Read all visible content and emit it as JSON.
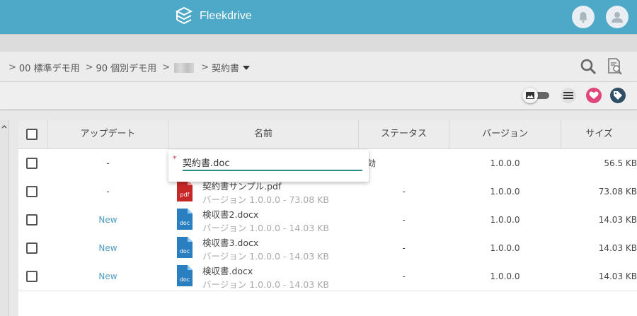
{
  "app": {
    "name": "Fleekdrive"
  },
  "breadcrumb": {
    "items": [
      "00 標準デモ用",
      "90 個別デモ用"
    ],
    "current": "契約書"
  },
  "table": {
    "columns": [
      "アップデート",
      "名前",
      "ステータス",
      "バージョン",
      "サイズ"
    ],
    "rows": [
      {
        "update": "-",
        "name": "",
        "version_line": "",
        "status": "有効",
        "version": "1.0.0.0",
        "size": "56.5 KB",
        "type": "doc"
      },
      {
        "update": "-",
        "name": "契約書サンプル.pdf",
        "version_line": "バージョン 1.0.0.0 - 73.08 KB",
        "status": "-",
        "version": "1.0.0.0",
        "size": "73.08 KB",
        "type": "pdf"
      },
      {
        "update": "New",
        "name": "検収書2.docx",
        "version_line": "バージョン 1.0.0.0 - 14.03 KB",
        "status": "-",
        "version": "1.0.0.0",
        "size": "14.03 KB",
        "type": "doc"
      },
      {
        "update": "New",
        "name": "検収書3.docx",
        "version_line": "バージョン 1.0.0.0 - 14.03 KB",
        "status": "-",
        "version": "1.0.0.0",
        "size": "14.03 KB",
        "type": "doc"
      },
      {
        "update": "New",
        "name": "検収書.docx",
        "version_line": "バージョン 1.0.0.0 - 14.03 KB",
        "status": "-",
        "version": "1.0.0.0",
        "size": "14.03 KB",
        "type": "doc"
      }
    ]
  },
  "rename": {
    "required_mark": "*",
    "value": "契約書.doc"
  },
  "icons": {
    "pdf_label": "pdf",
    "doc_label": "doc"
  },
  "colors": {
    "header": "#4ea8c7",
    "accent": "#2f8f86",
    "pdf": "#c62828",
    "doc": "#2a7fc0",
    "favorite": "#e0457b",
    "tag": "#2f4f66",
    "new_link": "#4f9cc2"
  }
}
